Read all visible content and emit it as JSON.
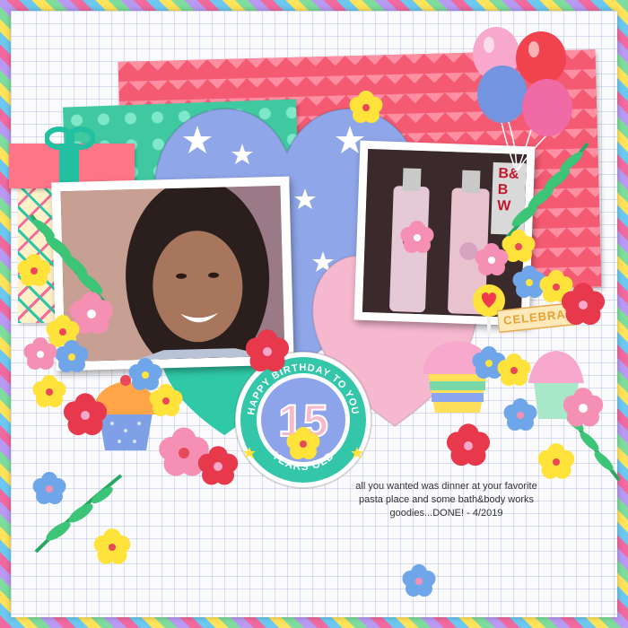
{
  "badge": {
    "top_text": "HAPPY BIRTHDAY TO YOU",
    "number": "15",
    "bottom_text": "YEARS OLD"
  },
  "tag": {
    "text": "CELEBRATE"
  },
  "photo2_sign": {
    "line1": "B&",
    "line2": "B",
    "line3": "W"
  },
  "caption": {
    "text": "all you wanted was dinner at your favorite pasta place and some bath&body works goodies...DONE! - 4/2019"
  },
  "colors": {
    "chevron_pink": "#f45a72",
    "teal": "#22c0a0",
    "periwinkle": "#8fa6e8",
    "light_pink": "#f6b8cf",
    "badge_blue": "#8ea4ea",
    "badge_white_ring": "#ffffff"
  },
  "decor": {
    "balloons": [
      "pink",
      "red",
      "blue",
      "pink"
    ],
    "flower_icons": [
      "flower-yellow",
      "flower-pink",
      "flower-red",
      "flower-blue"
    ]
  }
}
